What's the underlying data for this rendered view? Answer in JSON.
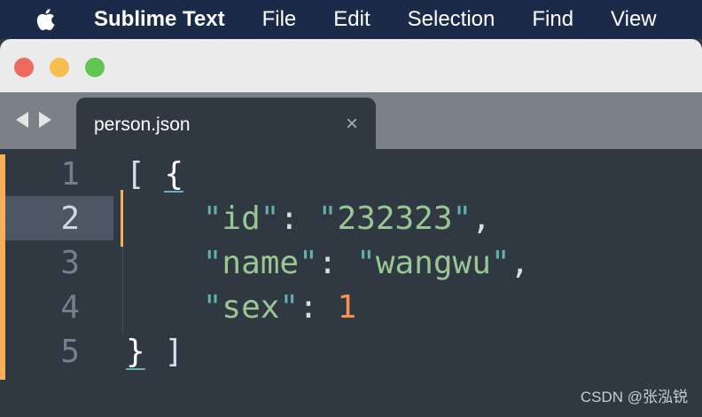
{
  "menubar": {
    "app_name": "Sublime Text",
    "items": [
      "File",
      "Edit",
      "Selection",
      "Find",
      "View"
    ]
  },
  "tabs": [
    {
      "label": "person.json",
      "close_glyph": "×",
      "active": true
    }
  ],
  "editor": {
    "active_line": 2,
    "lines": [
      {
        "number": "1",
        "text": "[ {"
      },
      {
        "number": "2",
        "text": "\"id\": \"232323\","
      },
      {
        "number": "3",
        "text": "\"name\": \"wangwu\","
      },
      {
        "number": "4",
        "text": "\"sex\": 1"
      },
      {
        "number": "5",
        "text": "} ]"
      }
    ],
    "tokens": {
      "open_bracket": "[",
      "open_brace": "{",
      "close_brace": "}",
      "close_bracket": "]",
      "id_key": "id",
      "id_value": "232323",
      "name_key": "name",
      "name_value": "wangwu",
      "sex_key": "sex",
      "sex_value": "1"
    }
  },
  "watermark": "CSDN @张泓锐",
  "colors": {
    "menubar_bg": "#1b2a48",
    "editor_bg": "#303841",
    "accent": "#f9ae58",
    "string": "#99c794",
    "number": "#f99157",
    "quote": "#5fb3b3"
  }
}
